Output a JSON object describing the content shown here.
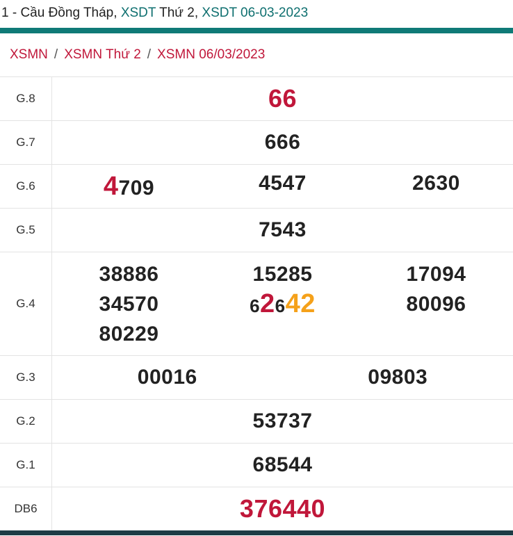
{
  "header": {
    "prefix": "1 - Cầu Đồng Tháp, ",
    "link1": "XSDT",
    "middle": " Thứ 2, ",
    "link2": "XSDT 06-03-2023"
  },
  "breadcrumb": [
    "XSMN",
    "XSMN Thứ 2",
    "XSMN 06/03/2023"
  ],
  "breadcrumb_sep": "/",
  "results": {
    "g8": {
      "label": "G.8",
      "value": "66"
    },
    "g7": {
      "label": "G.7",
      "value": "666"
    },
    "g6": {
      "label": "G.6",
      "v1_hl": "4",
      "v1_rest": "709",
      "v2": "4547",
      "v3": "2630"
    },
    "g5": {
      "label": "G.5",
      "value": "7543"
    },
    "g4": {
      "label": "G.4",
      "col1": [
        "38886",
        "34570",
        "80229"
      ],
      "col2_1": "15285",
      "col2_2_a": "6",
      "col2_2_b": "2",
      "col2_2_c": "6",
      "col2_2_d": "42",
      "col3": [
        "17094",
        "80096"
      ]
    },
    "g3": {
      "label": "G.3",
      "values": [
        "00016",
        "09803"
      ]
    },
    "g2": {
      "label": "G.2",
      "value": "53737"
    },
    "g1": {
      "label": "G.1",
      "value": "68544"
    },
    "db": {
      "label": "DB6",
      "value": "376440"
    }
  },
  "colors": {
    "teal": "#0f7a77",
    "red": "#c0173a",
    "orange": "#f5a11a",
    "footer": "#1d3c45"
  }
}
